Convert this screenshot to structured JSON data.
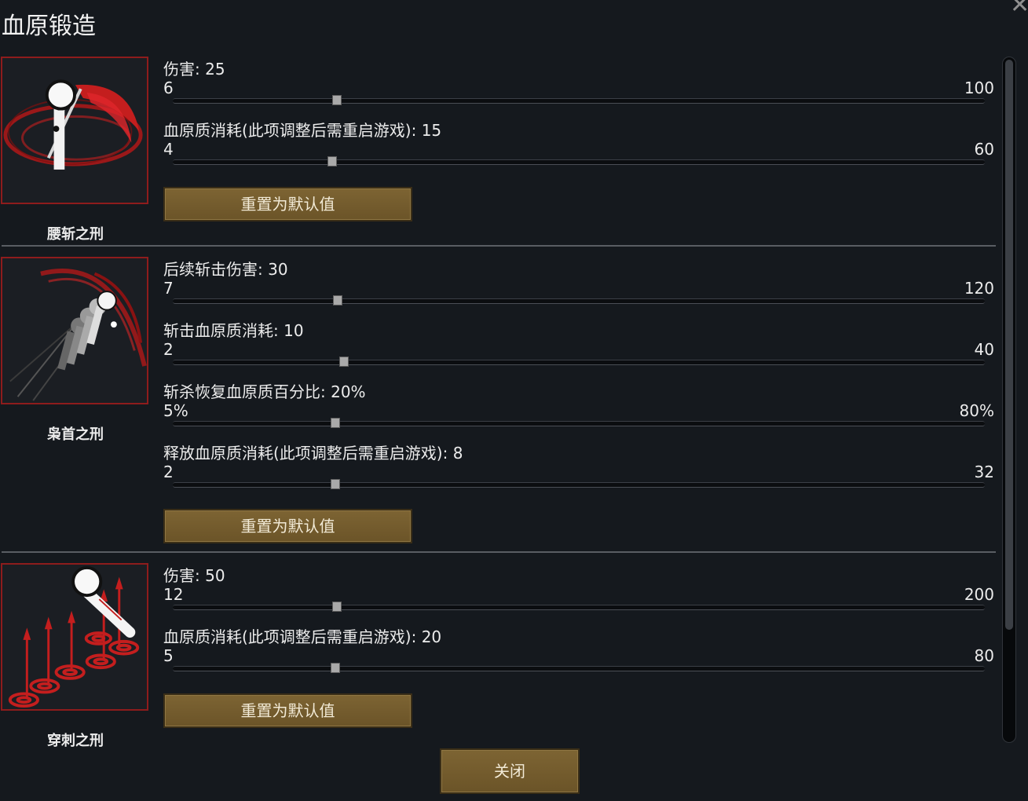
{
  "window": {
    "title": "血原锻造"
  },
  "skills": [
    {
      "name": "腰斩之刑",
      "sliders": [
        {
          "label": "伤害: 25",
          "min": "6",
          "max": "100",
          "value": 25,
          "min_value": 6,
          "max_value": 100
        },
        {
          "label": "血原质消耗(此项调整后需重启游戏): 15",
          "min": "4",
          "max": "60",
          "value": 15,
          "min_value": 4,
          "max_value": 60
        }
      ],
      "reset_label": "重置为默认值"
    },
    {
      "name": "枭首之刑",
      "sliders": [
        {
          "label": "后续斩击伤害: 30",
          "min": "7",
          "max": "120",
          "value": 30,
          "min_value": 7,
          "max_value": 120
        },
        {
          "label": "斩击血原质消耗: 10",
          "min": "2",
          "max": "40",
          "value": 10,
          "min_value": 2,
          "max_value": 40
        },
        {
          "label": "斩杀恢复血原质百分比: 20%",
          "min": "5%",
          "max": "80%",
          "value": 20,
          "min_value": 5,
          "max_value": 80
        },
        {
          "label": "释放血原质消耗(此项调整后需重启游戏): 8",
          "min": "2",
          "max": "32",
          "value": 8,
          "min_value": 2,
          "max_value": 32
        }
      ],
      "reset_label": "重置为默认值"
    },
    {
      "name": "穿刺之刑",
      "sliders": [
        {
          "label": "伤害: 50",
          "min": "12",
          "max": "200",
          "value": 50,
          "min_value": 12,
          "max_value": 200
        },
        {
          "label": "血原质消耗(此项调整后需重启游戏): 20",
          "min": "5",
          "max": "80",
          "value": 20,
          "min_value": 5,
          "max_value": 80
        }
      ],
      "reset_label": "重置为默认值"
    }
  ],
  "footer": {
    "close_label": "关闭"
  },
  "icons": {
    "skill_1": "waist-chop-scythe-icon",
    "skill_2": "beheading-dash-icon",
    "skill_3": "impale-spikes-icon",
    "window_close": "close-icon"
  },
  "colors": {
    "accent_red": "#8e1c1c",
    "button": "#7a6233",
    "background": "#15191e"
  }
}
